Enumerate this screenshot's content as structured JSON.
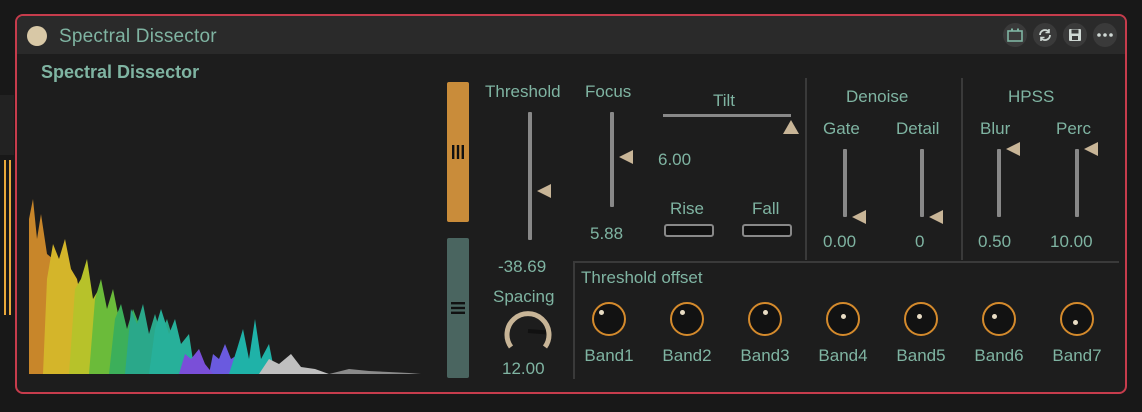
{
  "device": {
    "title": "Spectral Dissector",
    "header_title": "Spectral Dissector",
    "accent_color": "#7fb4a2",
    "border_color": "#c63c4c",
    "title_icons": [
      "midi-map-icon",
      "refresh-icon",
      "save-icon",
      "more-icon"
    ]
  },
  "controls": {
    "threshold": {
      "label": "Threshold",
      "value": "-38.69",
      "level": 0.38
    },
    "focus": {
      "label": "Focus",
      "value": "5.88",
      "level": 0.53
    },
    "tilt": {
      "label": "Tilt",
      "value": "6.00",
      "level": 1.0
    },
    "rise": {
      "label": "Rise"
    },
    "fall": {
      "label": "Fall"
    },
    "spacing": {
      "label": "Spacing",
      "value": "12.00",
      "level": 0.85
    }
  },
  "denoise": {
    "label": "Denoise",
    "gate": {
      "label": "Gate",
      "value": "0.00",
      "level": 0.0
    },
    "detail": {
      "label": "Detail",
      "value": "0",
      "level": 0.0
    }
  },
  "hpss": {
    "label": "HPSS",
    "blur": {
      "label": "Blur",
      "value": "0.50",
      "level": 1.0
    },
    "perc": {
      "label": "Perc",
      "value": "10.00",
      "level": 1.0
    }
  },
  "threshold_offset": {
    "label": "Threshold offset",
    "bands": [
      {
        "label": "Band1"
      },
      {
        "label": "Band2"
      },
      {
        "label": "Band3"
      },
      {
        "label": "Band4"
      },
      {
        "label": "Band5"
      },
      {
        "label": "Band6"
      },
      {
        "label": "Band7"
      }
    ]
  }
}
